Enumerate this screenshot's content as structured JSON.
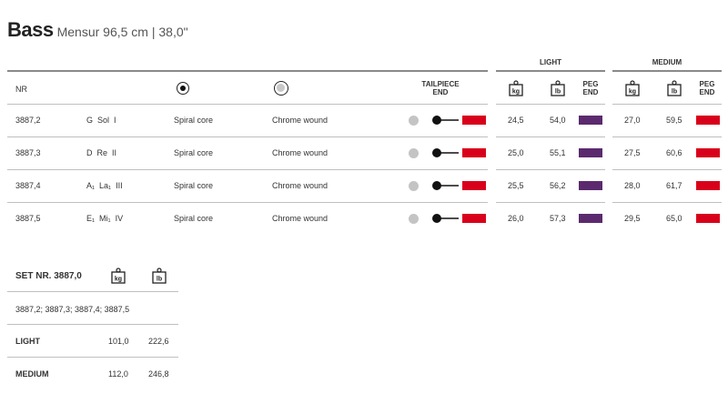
{
  "header": {
    "title": "Bass",
    "subtitle": "Mensur 96,5 cm | 38,0\""
  },
  "columns": {
    "nr": "NR",
    "tailpiece_end": [
      "TAILPIECE",
      "END"
    ],
    "light": "LIGHT",
    "medium": "MEDIUM",
    "kg": "kg",
    "lb": "lb",
    "peg_end": [
      "PEG",
      "END"
    ]
  },
  "colors": {
    "tailpiece_swatch": "#d9001b",
    "light_peg_swatch": "#5b2a6e",
    "medium_peg_swatch": "#d9001b",
    "gray_dot": "#c4c4c4"
  },
  "rows": [
    {
      "nr": "3887,2",
      "note": "G  Sol  I",
      "core": "Spiral core",
      "wound": "Chrome wound",
      "light_kg": "24,5",
      "light_lb": "54,0",
      "medium_kg": "27,0",
      "medium_lb": "59,5"
    },
    {
      "nr": "3887,3",
      "note": "D  Re  II",
      "core": "Spiral core",
      "wound": "Chrome wound",
      "light_kg": "25,0",
      "light_lb": "55,1",
      "medium_kg": "27,5",
      "medium_lb": "60,6"
    },
    {
      "nr": "3887,4",
      "note": "A₁  La₁  III",
      "core": "Spiral core",
      "wound": "Chrome wound",
      "light_kg": "25,5",
      "light_lb": "56,2",
      "medium_kg": "28,0",
      "medium_lb": "61,7"
    },
    {
      "nr": "3887,5",
      "note": "E₁  Mi₁  IV",
      "core": "Spiral core",
      "wound": "Chrome wound",
      "light_kg": "26,0",
      "light_lb": "57,3",
      "medium_kg": "29,5",
      "medium_lb": "65,0"
    }
  ],
  "set": {
    "title": "SET NR. 3887,0",
    "contents": "3887,2; 3887,3; 3887,4; 3887,5",
    "light_label": "LIGHT",
    "light_kg": "101,0",
    "light_lb": "222,6",
    "medium_label": "MEDIUM",
    "medium_kg": "112,0",
    "medium_lb": "246,8"
  }
}
